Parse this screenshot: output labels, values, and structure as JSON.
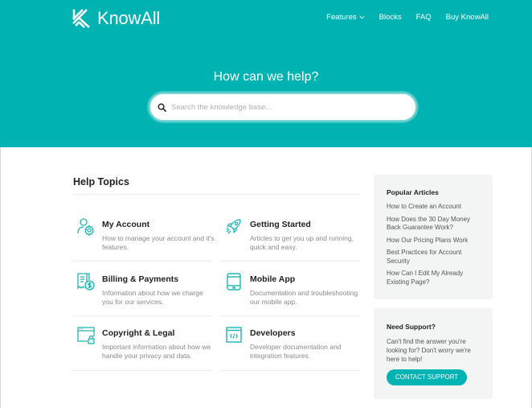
{
  "header": {
    "brand": "KnowAll",
    "nav": [
      {
        "label": "Features",
        "has_dropdown": true
      },
      {
        "label": "Blocks"
      },
      {
        "label": "FAQ"
      },
      {
        "label": "Buy KnowAll"
      }
    ]
  },
  "hero": {
    "title": "How can we help?",
    "search": {
      "placeholder": "Search the knowledge base...",
      "value": "",
      "icon": "search-icon"
    }
  },
  "help_topics": {
    "title": "Help Topics",
    "items": [
      {
        "title": "My Account",
        "description": "How to manage your account and it's features.",
        "icon": "user-gear-icon"
      },
      {
        "title": "Getting Started",
        "description": "Articles to get you up and running, quick and easy.",
        "icon": "rocket-icon"
      },
      {
        "title": "Billing & Payments",
        "description": "Information about how we charge you for our services.",
        "icon": "invoice-dollar-icon"
      },
      {
        "title": "Mobile App",
        "description": "Documentation and troubleshooting our mobile app.",
        "icon": "tablet-icon"
      },
      {
        "title": "Copyright & Legal",
        "description": "Important information about how we handle your privacy and data.",
        "icon": "browser-lock-icon"
      },
      {
        "title": "Developers",
        "description": "Developer documentation and integration features.",
        "icon": "browser-code-icon"
      }
    ]
  },
  "popular_articles": {
    "title": "Popular Articles",
    "items": [
      "How to Create an Account",
      "How Does the 30 Day Money Back Guarantee Work?",
      "How Our Pricing Plans Work",
      "Best Practices for Account Security",
      "How Can I Edit My Already Existing Page?"
    ]
  },
  "support": {
    "title": "Need Support?",
    "text": "Can't find the answer you're looking for? Don't worry we're here to help!",
    "button_label": "CONTACT SUPPORT"
  },
  "colors": {
    "accent": "#00b3b3",
    "card_bg": "#f3f4f4"
  }
}
